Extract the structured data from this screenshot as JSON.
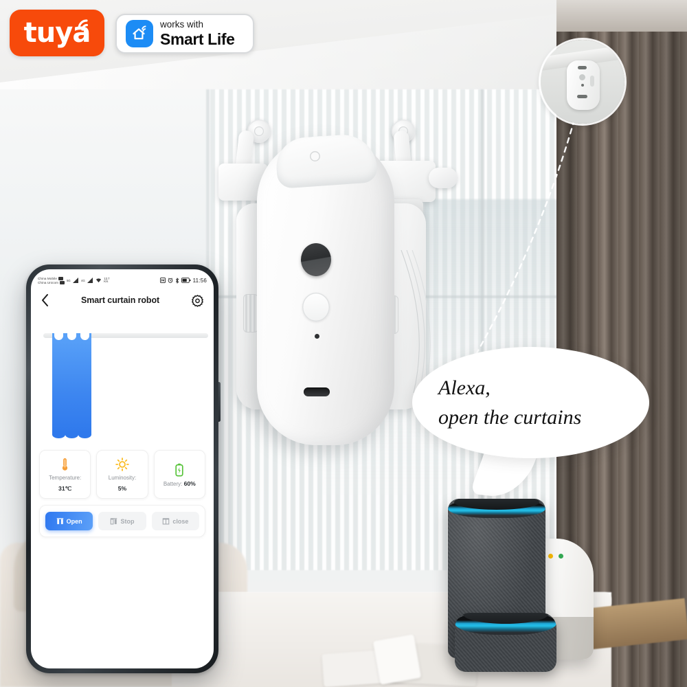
{
  "branding": {
    "tuya_logo": "tuya",
    "tuya_color": "#F74A0B",
    "smart_life_badge": {
      "icon": "home-wifi-icon",
      "icon_color": "#1C8CF5",
      "line1": "works with",
      "line2": "Smart Life"
    }
  },
  "phone": {
    "status_bar": {
      "carrier_1": "China Mobile",
      "carrier_2": "China Unicom",
      "network_1": "5G",
      "network_2": "4G",
      "speed_value": "13.7",
      "speed_unit": "K/s",
      "icons": [
        "nfc-icon",
        "alarm-icon",
        "bluetooth-icon",
        "battery-icon"
      ],
      "time": "11:56"
    },
    "header": {
      "back_icon": "chevron-left-icon",
      "title": "Smart curtain robot",
      "settings_icon": "gear-icon"
    },
    "curtain": {
      "rod_color": "#E9EBEC",
      "panel_color": "#3D86F0",
      "open_percent": 25
    },
    "sensors": [
      {
        "icon": "thermometer-icon",
        "icon_color": "#F59E38",
        "label": "Temperature:",
        "value": "31℃",
        "inline": false
      },
      {
        "icon": "sun-icon",
        "icon_color": "#FBBE28",
        "label": "Luminosity:",
        "value": "5%",
        "inline": false
      },
      {
        "icon": "battery-icon",
        "icon_color": "#57C33A",
        "label": "Battery:",
        "value": "60%",
        "inline": true
      }
    ],
    "controls": [
      {
        "icon": "curtain-open-icon",
        "label": "Open",
        "state": "active"
      },
      {
        "icon": "curtain-stop-icon",
        "label": "Stop",
        "state": "idle"
      },
      {
        "icon": "curtain-close-icon",
        "label": "close",
        "state": "idle"
      }
    ]
  },
  "scene": {
    "speech_bubble": {
      "line1": "Alexa,",
      "line2": "open the curtains"
    },
    "callout": {
      "name": "rail-mount-closeup",
      "connector": "dashed-line"
    },
    "devices": [
      {
        "name": "amazon-echo-speaker",
        "ring_color": "#23C0E8"
      },
      {
        "name": "google-home-speaker",
        "ring_color": "#FFFFFF"
      },
      {
        "name": "amazon-echo-dot-speaker",
        "ring_color": "#23C0E8"
      }
    ],
    "product": {
      "name": "smart-curtain-robot-device"
    }
  }
}
